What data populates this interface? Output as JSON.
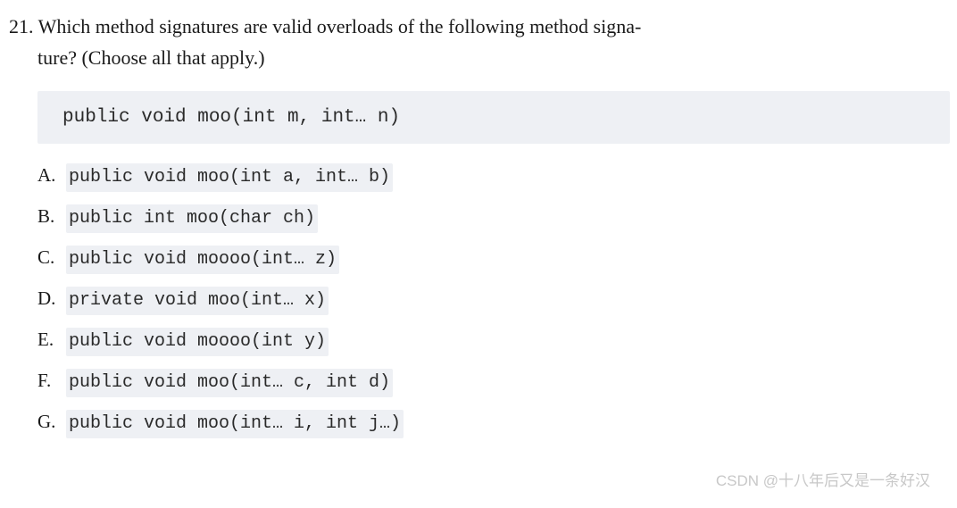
{
  "question": {
    "number": "21.",
    "text_line1": "Which method signatures are valid overloads of the following method signa-",
    "text_line2": "ture? (Choose all that apply.)",
    "code": "public void moo(int m, int… n)"
  },
  "options": [
    {
      "letter": "A.",
      "code": "public void moo(int a, int… b)"
    },
    {
      "letter": "B.",
      "code": "public int moo(char ch)"
    },
    {
      "letter": "C.",
      "code": "public void moooo(int… z)"
    },
    {
      "letter": "D.",
      "code": "private void moo(int… x)"
    },
    {
      "letter": "E.",
      "code": "public void moooo(int y)"
    },
    {
      "letter": "F.",
      "code": "public void moo(int… c, int d)"
    },
    {
      "letter": "G.",
      "code": "public void moo(int… i, int j…)"
    }
  ],
  "watermark": "CSDN @十八年后又是一条好汉"
}
